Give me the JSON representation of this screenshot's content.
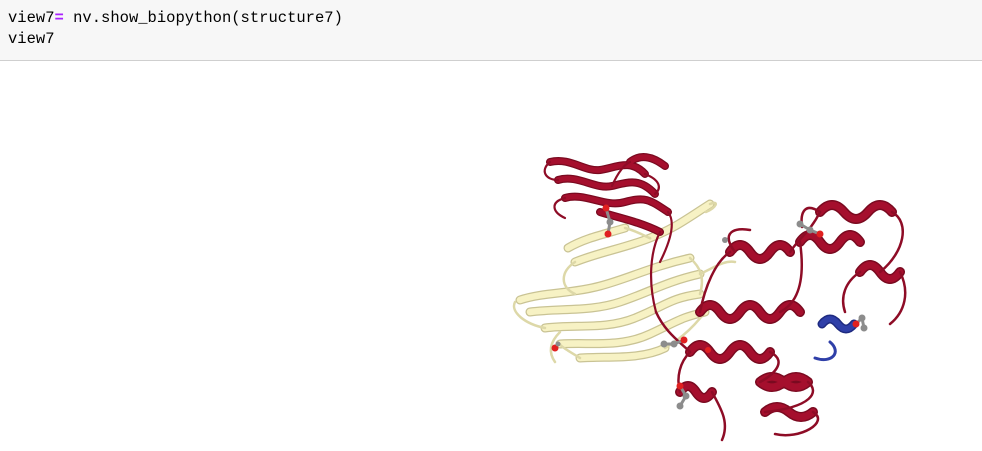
{
  "cell": {
    "line1_var": "view7",
    "line1_op": "=",
    "line1_rest": " nv.show_biopython(structure7)",
    "line2": "view7"
  },
  "viewer": {
    "molecule": "protein structure cartoon",
    "colors": {
      "chain_a": "#f5f0bf",
      "chain_b": "#a50f2d",
      "chain_c": "#2f3fa8",
      "ligand_carbon": "#8c8c8c",
      "ligand_oxygen": "#e02020"
    }
  }
}
